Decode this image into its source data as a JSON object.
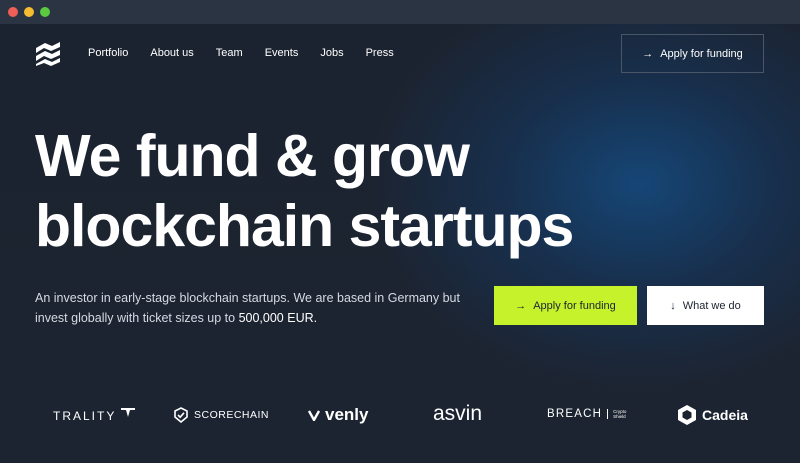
{
  "window": {
    "traffic_lights": [
      "#ee5f57",
      "#f5bd2f",
      "#5cc83f"
    ]
  },
  "nav": {
    "items": [
      "Portfolio",
      "About us",
      "Team",
      "Events",
      "Jobs",
      "Press"
    ],
    "cta_label": "Apply for funding"
  },
  "hero": {
    "title_line1": "We fund & grow",
    "title_line2": "blockchain startups",
    "description_part1": "An investor in early-stage blockchain startups. We are based in Germany but invest globally with ticket sizes up to ",
    "description_amount": "500,000 EUR.",
    "primary_button": "Apply for funding",
    "secondary_button": "What we do"
  },
  "portfolio": {
    "logos": [
      "TRALITY",
      "SCORECHAIN",
      "venly",
      "asvin",
      "BREACH",
      "Crypto Shield",
      "Cadeia"
    ]
  },
  "colors": {
    "accent": "#c5f22a",
    "background": "#1c2330"
  }
}
